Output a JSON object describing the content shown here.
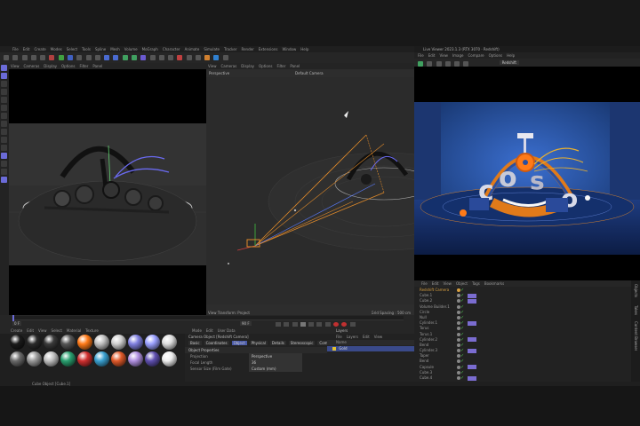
{
  "app": {
    "main_menu": [
      "File",
      "Edit",
      "Create",
      "Modes",
      "Select",
      "Tools",
      "Spline",
      "Mesh",
      "Volume",
      "MoGraph",
      "Character",
      "Animate",
      "Simulate",
      "Tracker",
      "Render",
      "Extensions",
      "Window",
      "Help"
    ],
    "left_viewport_menu": [
      "View",
      "Cameras",
      "Display",
      "Options",
      "Filter",
      "Panel"
    ],
    "center_viewport_menu": [
      "View",
      "Cameras",
      "Display",
      "Options",
      "Filter",
      "Panel"
    ],
    "center_viewport_title": "Perspective",
    "center_viewport_camera": "Default Camera",
    "center_viewport_selection": "Edit Selection",
    "center_viewport_footer_left": "View Transform: Project",
    "center_viewport_footer_right": "Grid Spacing : 500 cm"
  },
  "render_window": {
    "title": "Live Viewer 2023.1.3 (RTX 3070 · Redshift)",
    "menu": [
      "File",
      "Edit",
      "View",
      "Image",
      "Compare",
      "Options",
      "Help"
    ],
    "selected_preset": "Redshift"
  },
  "object_manager": {
    "menu": [
      "File",
      "Edit",
      "View",
      "Object",
      "Tags",
      "Bookmarks"
    ],
    "objects": [
      {
        "name": "Redshift Camera",
        "color": "#d8a040",
        "tag": false
      },
      {
        "name": "Cube.1",
        "color": "#888",
        "tag": true
      },
      {
        "name": "Cube.2",
        "color": "#888",
        "tag": true
      },
      {
        "name": "Volume Builder.1",
        "color": "#888",
        "tag": false
      },
      {
        "name": "Circle",
        "color": "#888",
        "tag": false
      },
      {
        "name": "Null",
        "color": "#888",
        "tag": false
      },
      {
        "name": "Cylinder.1",
        "color": "#888",
        "tag": true
      },
      {
        "name": "Torus",
        "color": "#888",
        "tag": false
      },
      {
        "name": "Torus.1",
        "color": "#888",
        "tag": false
      },
      {
        "name": "Cylinder.2",
        "color": "#888",
        "tag": true
      },
      {
        "name": "Bend",
        "color": "#888",
        "tag": false
      },
      {
        "name": "Cylinder.3",
        "color": "#888",
        "tag": true
      },
      {
        "name": "Taper",
        "color": "#888",
        "tag": false
      },
      {
        "name": "Bend",
        "color": "#888",
        "tag": false
      },
      {
        "name": "Capsule",
        "color": "#888",
        "tag": true
      },
      {
        "name": "Cube.3",
        "color": "#888",
        "tag": false
      },
      {
        "name": "Cube.4",
        "color": "#888",
        "tag": true
      }
    ],
    "side_tabs": [
      "Objects",
      "Takes",
      "Content Browser"
    ]
  },
  "material_manager": {
    "menu": [
      "Create",
      "Edit",
      "View",
      "Select",
      "Material",
      "Texture"
    ],
    "row1": [
      "#1a1a1a",
      "#2a2a2a",
      "#3a3a3a",
      "#555",
      "#ff7a18",
      "#bfbfbf",
      "#cfcfcf",
      "#8080e0",
      "#9aa0ff",
      "#ddd"
    ],
    "row2": [
      "#6a6a6a",
      "#999",
      "#c0c0c0",
      "#2aa070",
      "#d03030",
      "#3aa0d0",
      "#e05a2a",
      "#b090e0",
      "#6050b0",
      "#eee"
    ]
  },
  "attributes": {
    "menu": [
      "Mode",
      "Edit",
      "User Data"
    ],
    "object_title": "Camera Object [Redshift Camera]",
    "tabs": [
      "Basic",
      "Coordinates",
      "Object",
      "Physical",
      "Details",
      "Stereoscopic",
      "Composition",
      "Spherical"
    ],
    "section": "Object Properties",
    "rows": [
      {
        "label": "Projection",
        "value": "Perspective"
      },
      {
        "label": "Focal Length",
        "value": "36"
      },
      {
        "label": "Sensor Size (Film Gate)",
        "value": "Custom (mm)"
      }
    ]
  },
  "layers": {
    "title": "Layers",
    "menu": [
      "File",
      "Layers",
      "Edit",
      "View"
    ],
    "header": "Name",
    "selected_layer": "Gold"
  },
  "timeline": {
    "start_frame": "0 F",
    "end_frame": "90 F",
    "current_frame": "0 F"
  },
  "status": {
    "left": "Cube Object [Cube.1]"
  }
}
